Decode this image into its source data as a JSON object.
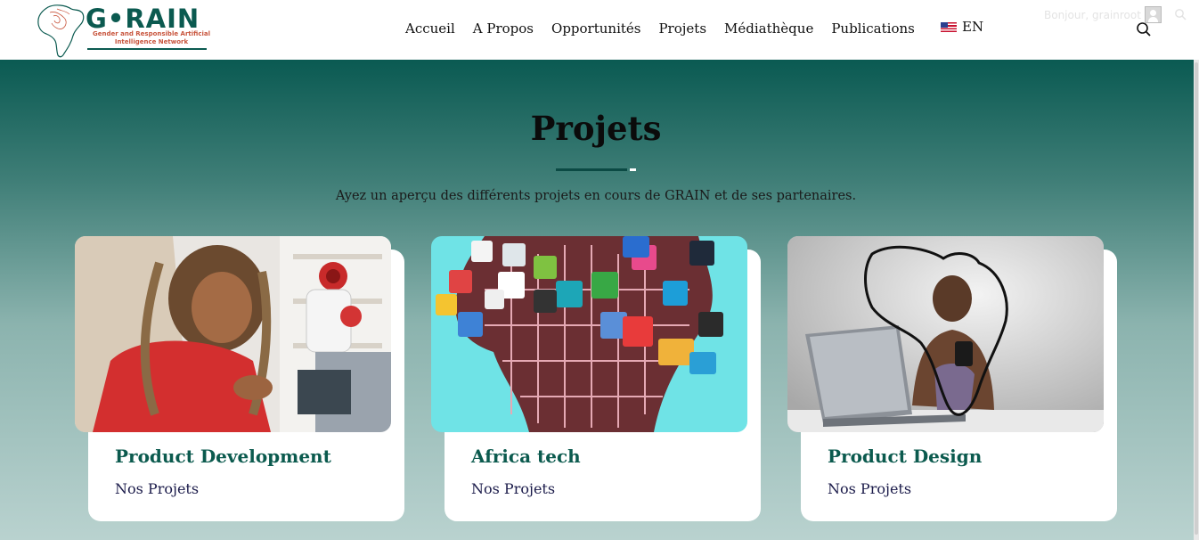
{
  "brand": {
    "logo_word": "G•RAIN",
    "logo_subtitle": "Gender and Responsible Artificial Intelligence Network",
    "colors": {
      "primary": "#0b5a50",
      "accent": "#c8553d"
    }
  },
  "nav": {
    "items": [
      {
        "label": "Accueil"
      },
      {
        "label": "A Propos"
      },
      {
        "label": "Opportunités"
      },
      {
        "label": "Projets"
      },
      {
        "label": "Médiathèque"
      },
      {
        "label": "Publications"
      }
    ],
    "language": "EN",
    "search_icon": "search-icon"
  },
  "user_bar": {
    "greeting": "Bonjour, grainroot",
    "avatar_icon": "user-avatar-icon"
  },
  "hero": {
    "title": "Projets",
    "subtitle": "Ayez un aperçu des différents projets en cours de GRAIN et de ses partenaires."
  },
  "cards": [
    {
      "title": "Product Development",
      "category": "Nos Projets",
      "image": "woman-building-robot-photo"
    },
    {
      "title": "Africa tech",
      "category": "Nos Projets",
      "image": "africa-circuit-app-icons-illustration"
    },
    {
      "title": "Product Design",
      "category": "Nos Projets",
      "image": "woman-laptop-africa-outline-photo"
    }
  ]
}
